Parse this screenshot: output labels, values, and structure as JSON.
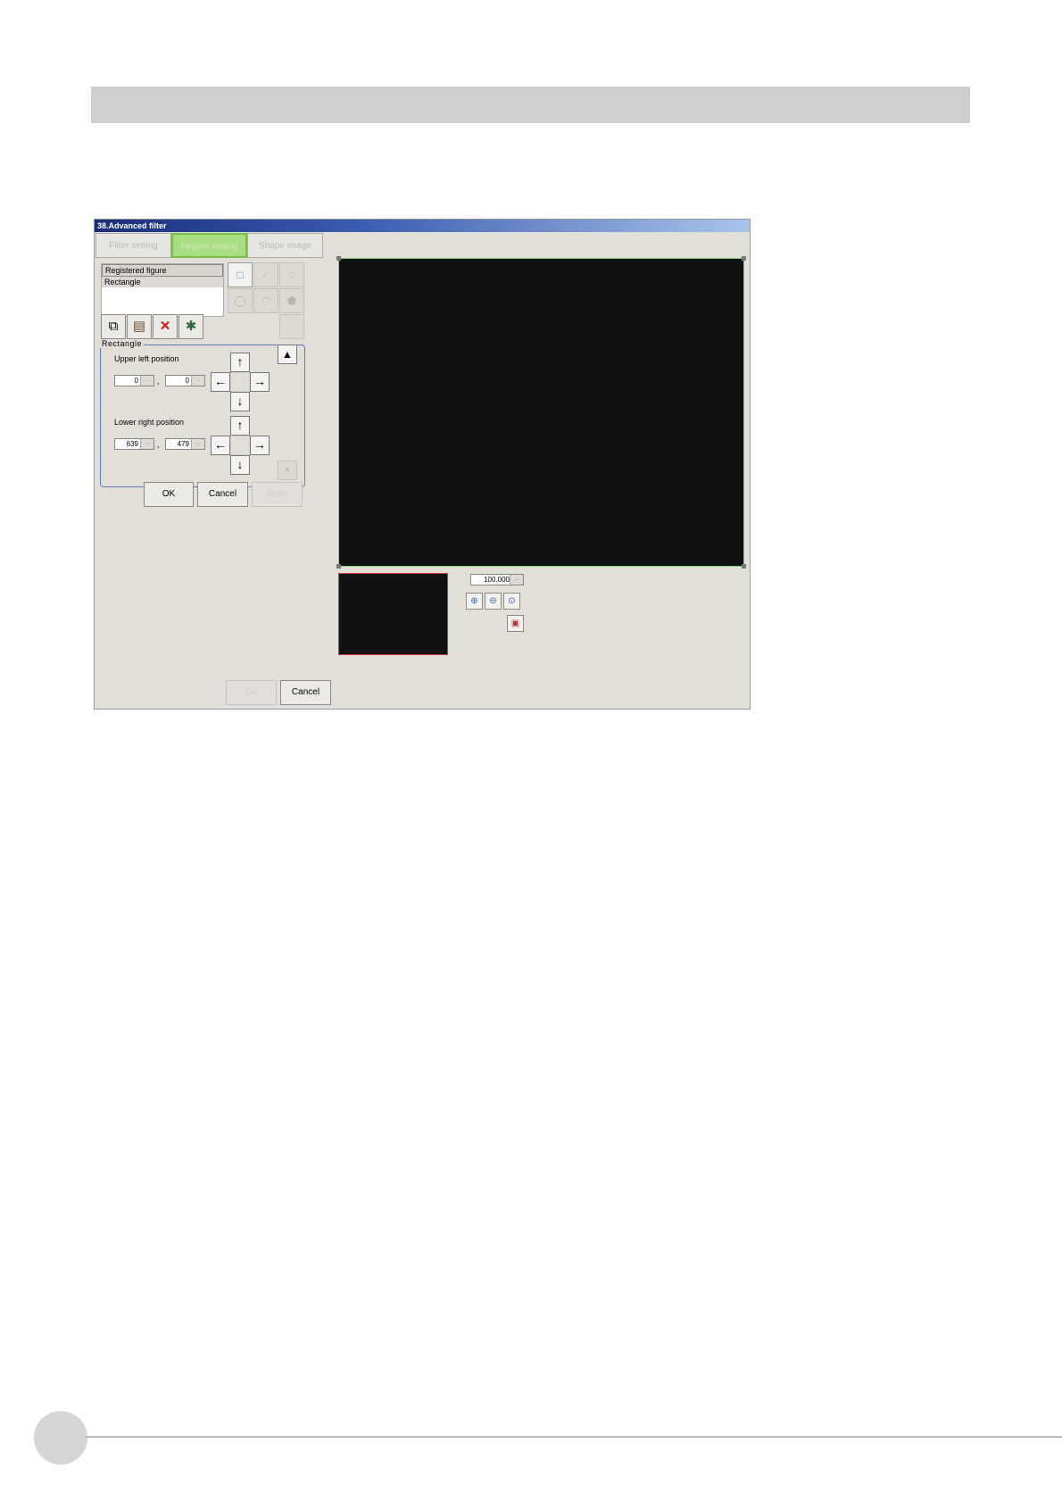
{
  "window": {
    "title": "38.Advanced filter"
  },
  "tabs": [
    {
      "label": "Filter setting",
      "active": false
    },
    {
      "label": "Region setting",
      "active": true
    },
    {
      "label": "Shape image",
      "active": false
    }
  ],
  "figure_list": {
    "header": "Registered figure",
    "items": [
      "Rectangle"
    ]
  },
  "rectangle_group": {
    "legend": "Rectangle",
    "upper_left_label": "Upper left position",
    "upper_left_x": "0",
    "upper_left_y": "0",
    "lower_right_label": "Lower right position",
    "lower_right_x": "639",
    "lower_right_y": "479",
    "separator": ","
  },
  "arrows": {
    "up": "↑",
    "down": "↓",
    "left": "←",
    "right": "→",
    "scroll_up": "▲",
    "scroll_down": "▼"
  },
  "edit_buttons": {
    "ok": "OK",
    "cancel": "Cancel",
    "apply": "Apply"
  },
  "zoom": {
    "value": "100.000"
  },
  "dialog_buttons": {
    "ok": "OK",
    "cancel": "Cancel"
  },
  "icons": [
    "copy-icon",
    "paste-icon",
    "delete-icon",
    "color-icon",
    "zoom-in-icon",
    "zoom-out-icon",
    "zoom-fit-icon",
    "fit-window-icon"
  ],
  "colors": {
    "title_start": "#1a2e7a",
    "active_tab": "#a9dd82",
    "canvas_border": "#7fd27f",
    "thumb_border": "#d03b3b",
    "group_border": "#5b7dc8"
  }
}
